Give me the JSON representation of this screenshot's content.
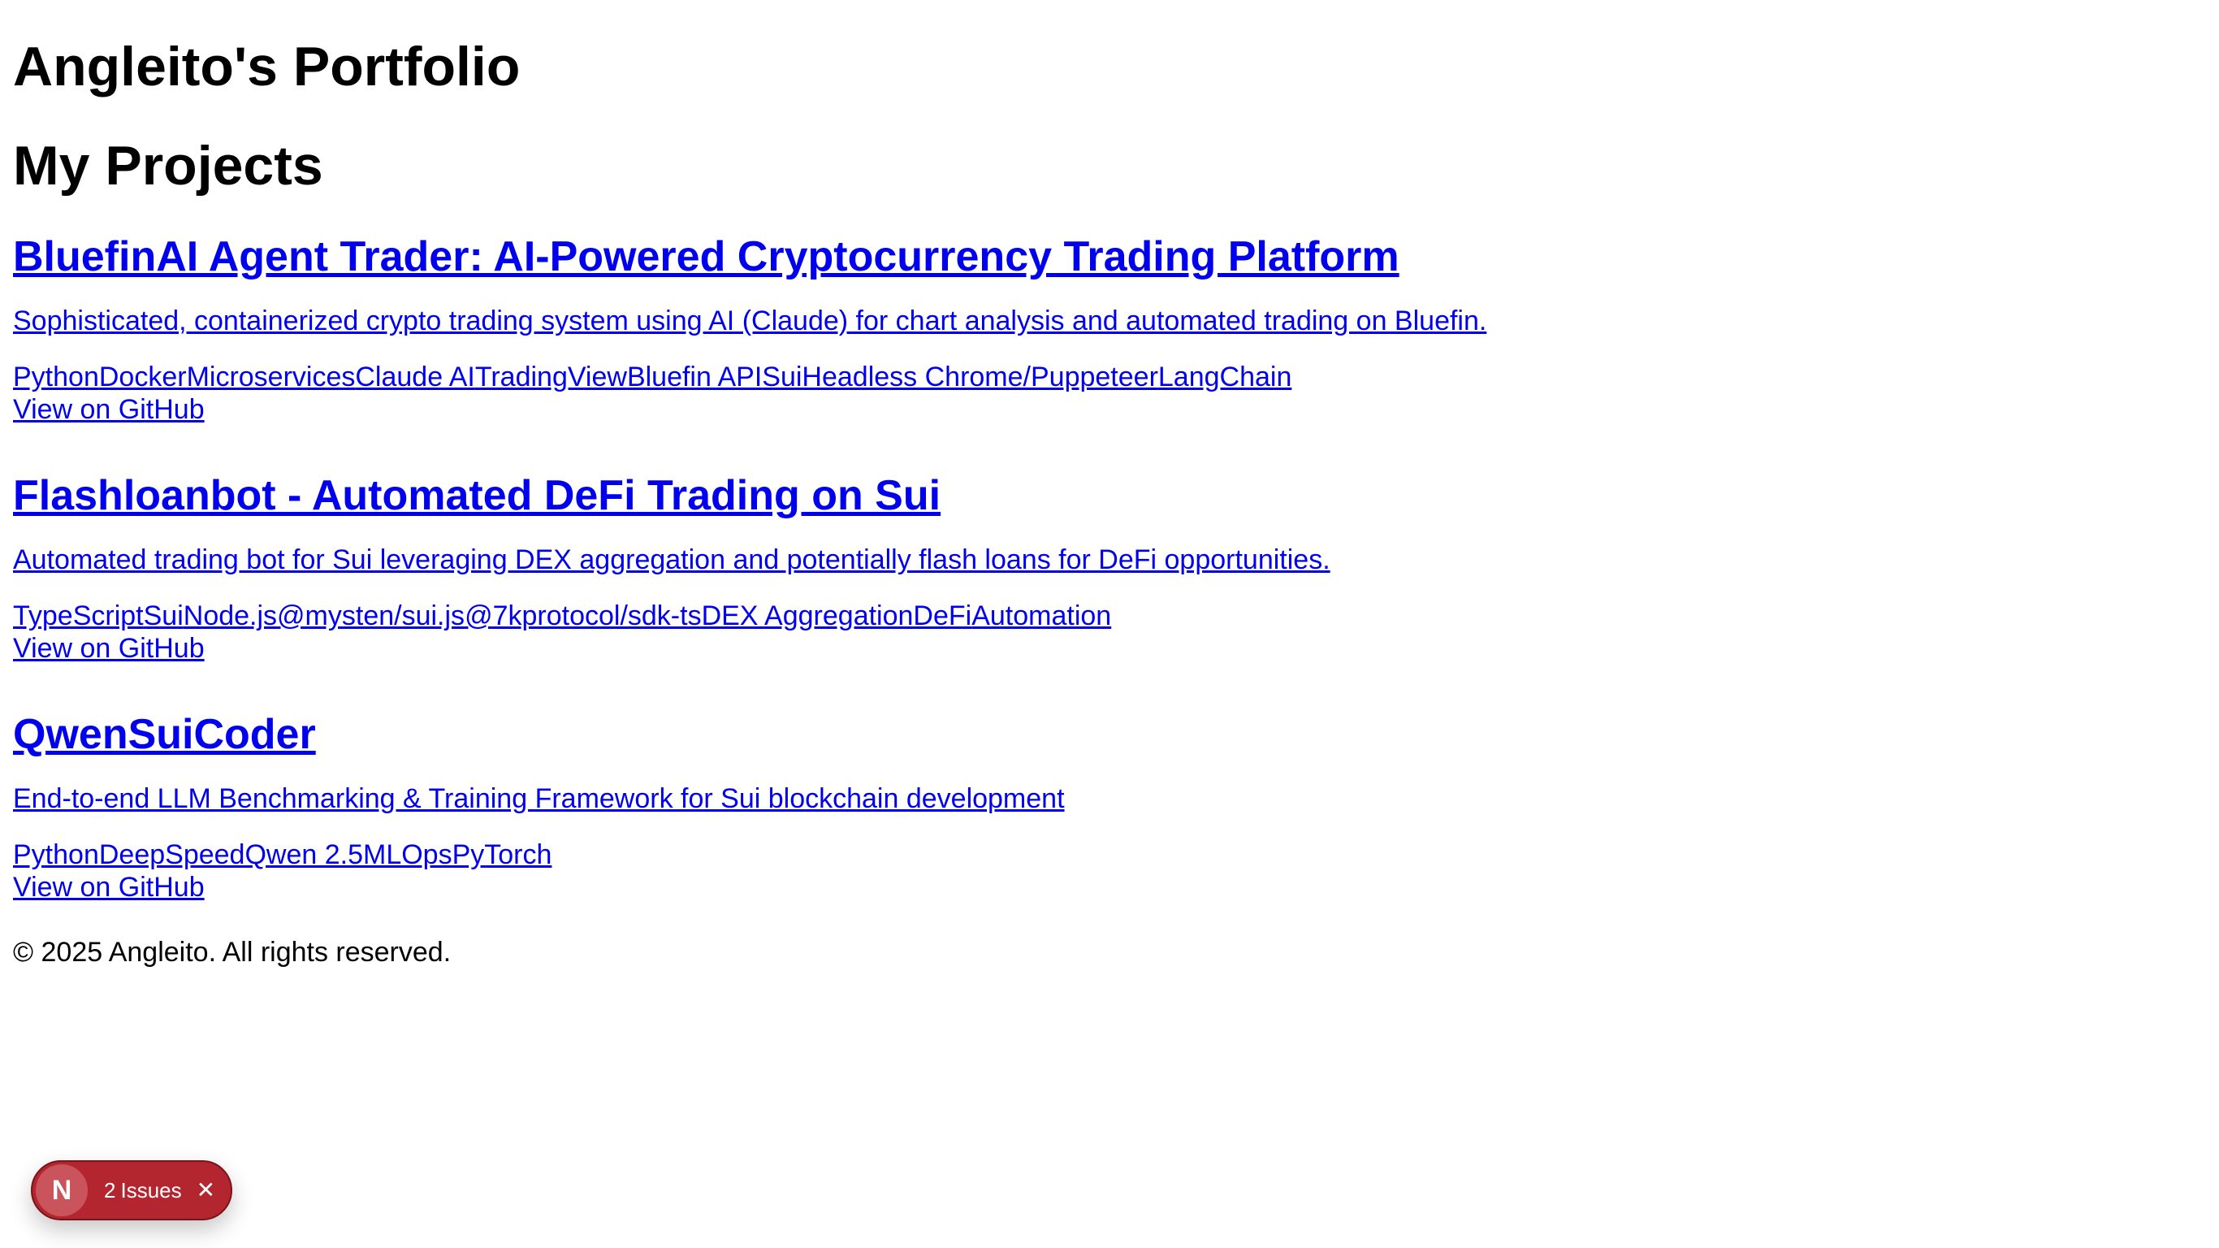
{
  "header": {
    "site_title": "Angleito's Portfolio",
    "section_title": "My Projects"
  },
  "projects": [
    {
      "title": "BluefinAI Agent Trader: AI-Powered Cryptocurrency Trading Platform",
      "description": "Sophisticated, containerized crypto trading system using AI (Claude) for chart analysis and automated trading on Bluefin.",
      "tags": [
        "Python",
        "Docker",
        "Microservices",
        "Claude AI",
        "TradingView",
        "Bluefin API",
        "Sui",
        "Headless Chrome/Puppeteer",
        "LangChain"
      ],
      "github_label": "View on GitHub"
    },
    {
      "title": "Flashloanbot - Automated DeFi Trading on Sui",
      "description": "Automated trading bot for Sui leveraging DEX aggregation and potentially flash loans for DeFi opportunities.",
      "tags": [
        "TypeScript",
        "Sui",
        "Node.js",
        "@mysten/sui.js",
        "@7kprotocol/sdk-ts",
        "DEX Aggregation",
        "DeFi",
        "Automation"
      ],
      "github_label": "View on GitHub"
    },
    {
      "title": "QwenSuiCoder",
      "description": "End-to-end LLM Benchmarking & Training Framework for Sui blockchain development",
      "tags": [
        "Python",
        "DeepSpeed",
        "Qwen 2.5",
        "MLOps",
        "PyTorch"
      ],
      "github_label": "View on GitHub"
    }
  ],
  "footer": {
    "text": "© 2025 Angleito. All rights reserved."
  },
  "dev_overlay": {
    "logo_glyph": "N",
    "issue_count": "2",
    "issue_label": "Issues",
    "close_glyph": "✕",
    "accent_color": "#b3262f"
  }
}
